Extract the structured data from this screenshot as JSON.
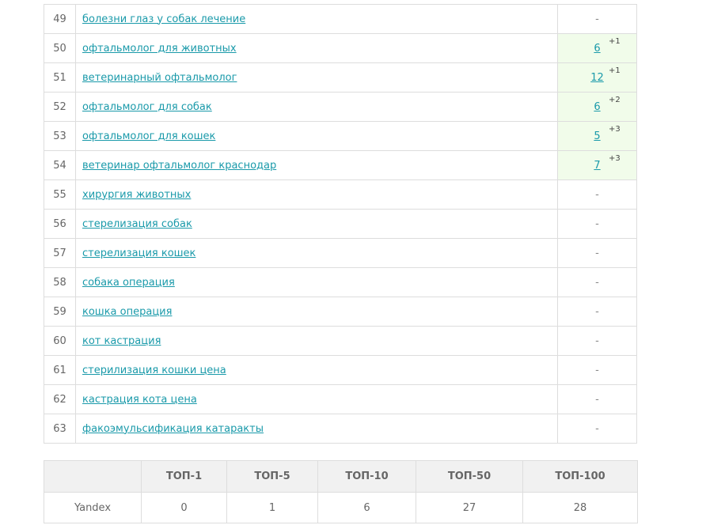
{
  "rows": [
    {
      "num": "49",
      "keyword": "болезни глаз у собак лечение",
      "pos": "-",
      "delta": ""
    },
    {
      "num": "50",
      "keyword": "офтальмолог для животных",
      "pos": "6",
      "delta": "+1"
    },
    {
      "num": "51",
      "keyword": "ветеринарный офтальмолог",
      "pos": "12",
      "delta": "+1"
    },
    {
      "num": "52",
      "keyword": "офтальмолог для собак",
      "pos": "6",
      "delta": "+2"
    },
    {
      "num": "53",
      "keyword": "офтальмолог для кошек",
      "pos": "5",
      "delta": "+3"
    },
    {
      "num": "54",
      "keyword": "ветеринар офтальмолог краснодар",
      "pos": "7",
      "delta": "+3"
    },
    {
      "num": "55",
      "keyword": "хирургия животных",
      "pos": "-",
      "delta": ""
    },
    {
      "num": "56",
      "keyword": "стерелизация собак",
      "pos": "-",
      "delta": ""
    },
    {
      "num": "57",
      "keyword": "стерелизация кошек",
      "pos": "-",
      "delta": ""
    },
    {
      "num": "58",
      "keyword": "собака операция",
      "pos": "-",
      "delta": ""
    },
    {
      "num": "59",
      "keyword": "кошка операция",
      "pos": "-",
      "delta": ""
    },
    {
      "num": "60",
      "keyword": "кот кастрация",
      "pos": "-",
      "delta": ""
    },
    {
      "num": "61",
      "keyword": "стерилизация кошки цена",
      "pos": "-",
      "delta": ""
    },
    {
      "num": "62",
      "keyword": "кастрация кота цена",
      "pos": "-",
      "delta": ""
    },
    {
      "num": "63",
      "keyword": "факоэмульсификация катаракты",
      "pos": "-",
      "delta": ""
    }
  ],
  "summary": {
    "headers": [
      "",
      "ТОП-1",
      "ТОП-5",
      "ТОП-10",
      "ТОП-50",
      "ТОП-100"
    ],
    "row": [
      "Yandex",
      "0",
      "1",
      "6",
      "27",
      "28"
    ]
  },
  "colors": {
    "link": "#1a9aaa",
    "highlight_bg": "#f1fcea",
    "border": "#dddddd",
    "header_bg": "#f1f1f1"
  }
}
